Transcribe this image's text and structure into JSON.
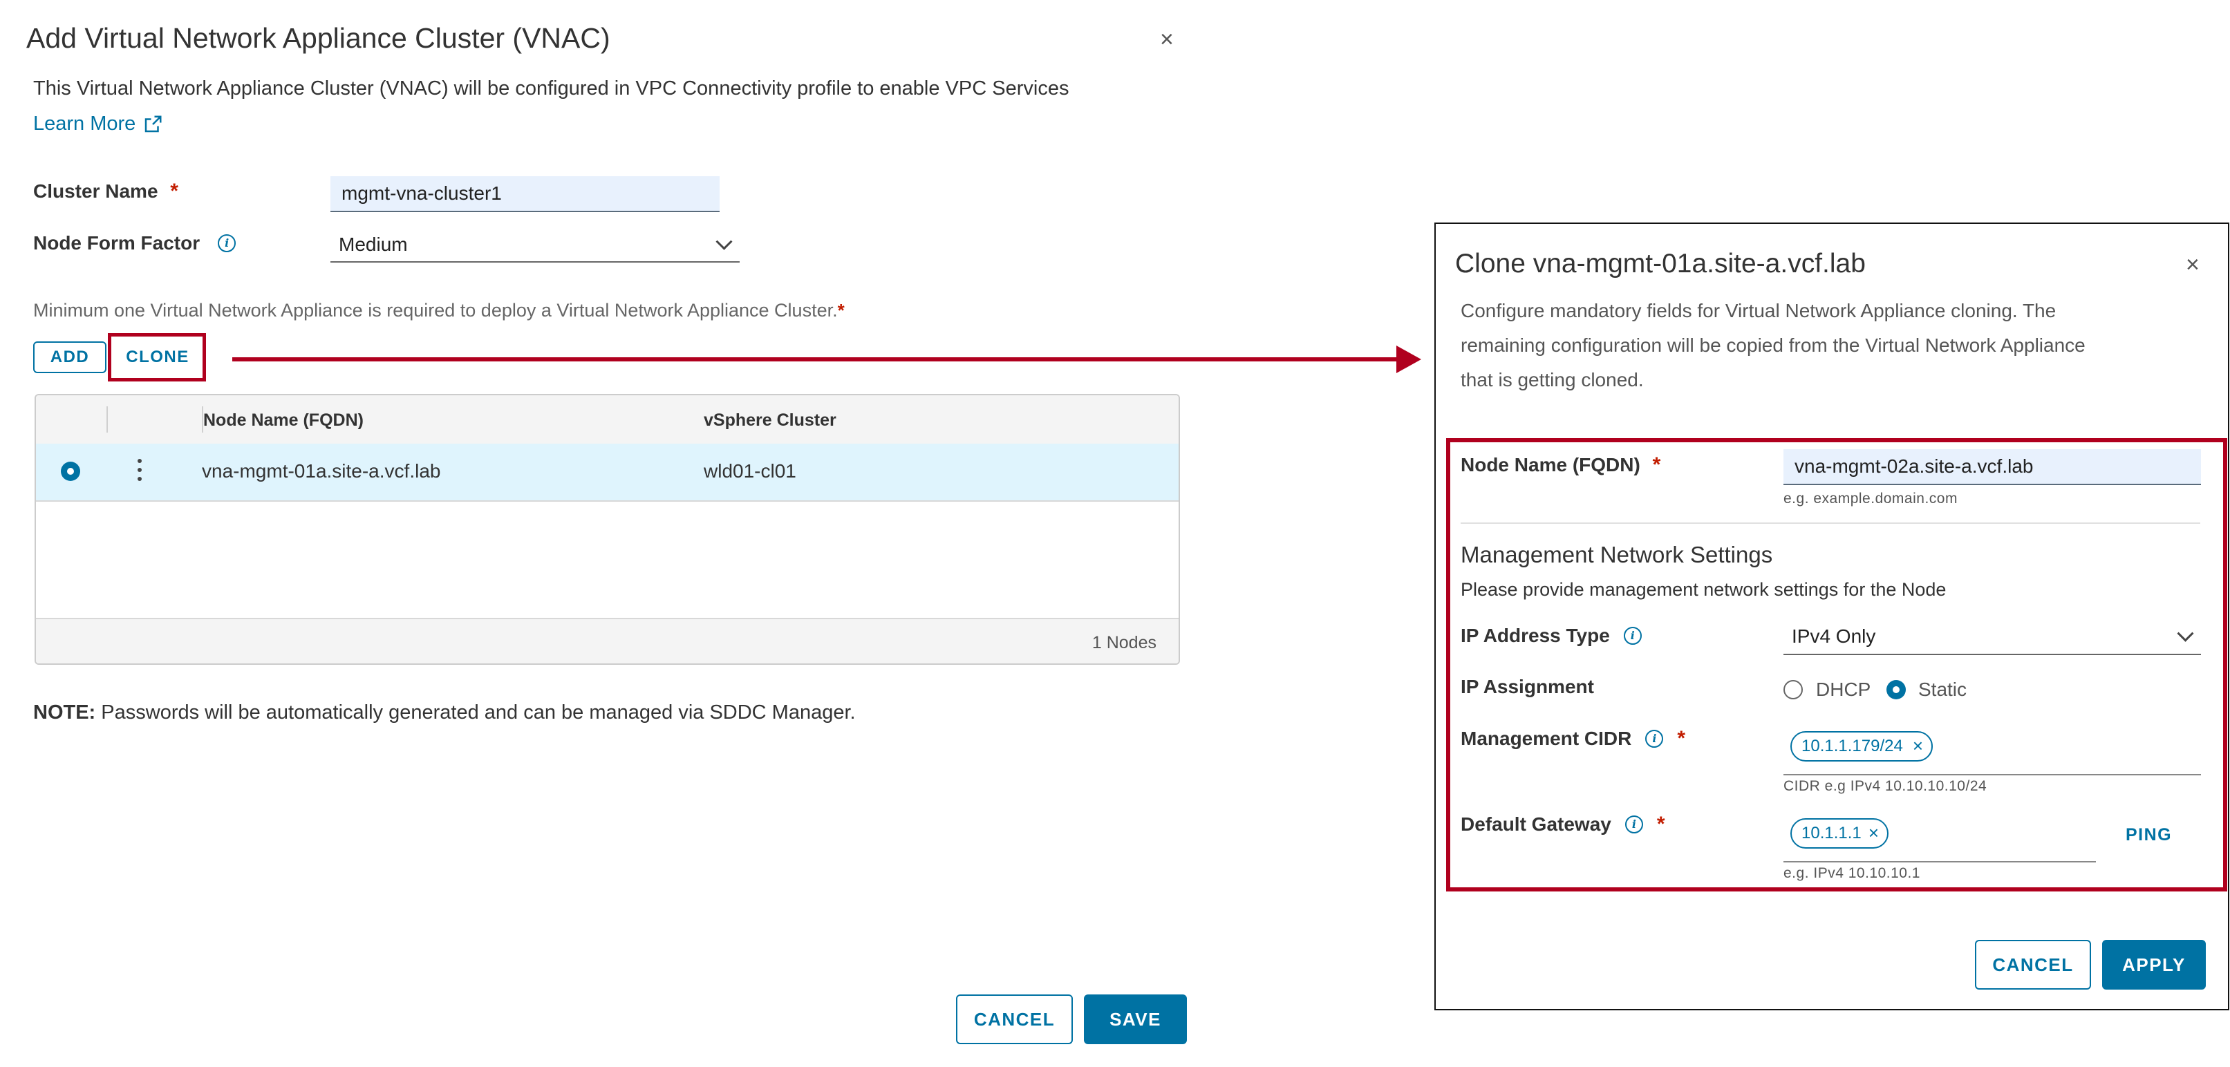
{
  "main_dialog": {
    "title": "Add Virtual Network Appliance Cluster (VNAC)",
    "close_glyph": "×",
    "description": "This Virtual Network Appliance Cluster (VNAC) will be configured in VPC Connectivity profile to enable VPC Services",
    "learn_more": "Learn More",
    "cluster_name_label": "Cluster Name",
    "cluster_name_value": "mgmt-vna-cluster1",
    "form_factor_label": "Node Form Factor",
    "form_factor_value": "Medium",
    "requirement_note": "Minimum one Virtual Network Appliance is required to deploy a Virtual Network Appliance Cluster.",
    "add_label": "ADD",
    "clone_label": "CLONE",
    "table": {
      "headers": [
        "Node Name (FQDN)",
        "vSphere Cluster"
      ],
      "rows": [
        {
          "node_name": "vna-mgmt-01a.site-a.vcf.lab",
          "cluster": "wld01-cl01"
        }
      ],
      "footer": "1 Nodes"
    },
    "note_bold": "NOTE:",
    "note_text": " Passwords will be automatically generated and can be managed via SDDC Manager.",
    "cancel_label": "CANCEL",
    "save_label": "SAVE"
  },
  "clone_dialog": {
    "title": "Clone vna-mgmt-01a.site-a.vcf.lab",
    "close_glyph": "×",
    "desc_line1": "Configure mandatory fields for Virtual Network Appliance cloning. The",
    "desc_line2": "remaining configuration will be copied from the Virtual Network Appliance",
    "desc_line3": "that is getting cloned.",
    "node_name_label": "Node Name (FQDN)",
    "node_name_value": "vna-mgmt-02a.site-a.vcf.lab",
    "node_name_hint": "e.g. example.domain.com",
    "mgmt_heading": "Management Network Settings",
    "mgmt_subheading": "Please provide management network settings for the Node",
    "ip_type_label": "IP Address Type",
    "ip_type_value": "IPv4 Only",
    "ip_assign_label": "IP Assignment",
    "dhcp_label": "DHCP",
    "static_label": "Static",
    "cidr_label": "Management CIDR",
    "cidr_value": "10.1.1.179/24",
    "cidr_hint": "CIDR e.g IPv4 10.10.10.10/24",
    "gateway_label": "Default Gateway",
    "gateway_value": "10.1.1.1",
    "gateway_hint": "e.g. IPv4 10.10.10.1",
    "ping_label": "PING",
    "cancel_label": "CANCEL",
    "apply_label": "APPLY"
  },
  "colors": {
    "accent": "#0072a3",
    "highlight_red": "#b0001e",
    "selected_row": "#dff4fd"
  }
}
